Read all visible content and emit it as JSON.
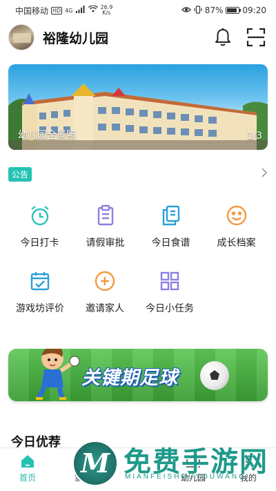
{
  "status_bar": {
    "carrier": "中国移动",
    "hd": "HD",
    "signal": "4G",
    "net_speed_value": "26.9",
    "net_speed_unit": "K/s",
    "battery": "87%",
    "battery_level": 0.87,
    "time": "09:20"
  },
  "header": {
    "title": "裕隆幼儿园"
  },
  "banner": {
    "caption": "幼儿园全景照",
    "index": "1/3"
  },
  "notice": {
    "badge": "公告"
  },
  "grid": {
    "row1": [
      {
        "label": "今日打卡",
        "icon": "alarm-clock-icon",
        "color": "#2bc3b6"
      },
      {
        "label": "请假审批",
        "icon": "clipboard-icon",
        "color": "#8a7fe0"
      },
      {
        "label": "今日食谱",
        "icon": "documents-icon",
        "color": "#2aa0d8"
      },
      {
        "label": "成长档案",
        "icon": "smile-icon",
        "color": "#f3983e"
      }
    ],
    "row2": [
      {
        "label": "游戏坊评价",
        "icon": "calendar-check-icon",
        "color": "#2aa0d8"
      },
      {
        "label": "邀请家人",
        "icon": "plus-circle-icon",
        "color": "#f3983e"
      },
      {
        "label": "今日小任务",
        "icon": "grid-icon",
        "color": "#8a7fe0"
      }
    ]
  },
  "promo": {
    "title": "关键期足球"
  },
  "section": {
    "title": "今日优荐"
  },
  "tabbar": {
    "tabs": [
      {
        "label": "首页",
        "active": true
      },
      {
        "label": "家园"
      },
      {
        "label": ""
      },
      {
        "label": "幼儿园"
      },
      {
        "label": "我的"
      }
    ]
  },
  "watermark": {
    "logo": "M",
    "text": "免费手游网",
    "sub": "MIANFEISHOUYOUWANG"
  },
  "colors": {
    "accent": "#25c2b4",
    "promo_green": "#4db548",
    "promo_text_outline": "#1d5fb5"
  }
}
